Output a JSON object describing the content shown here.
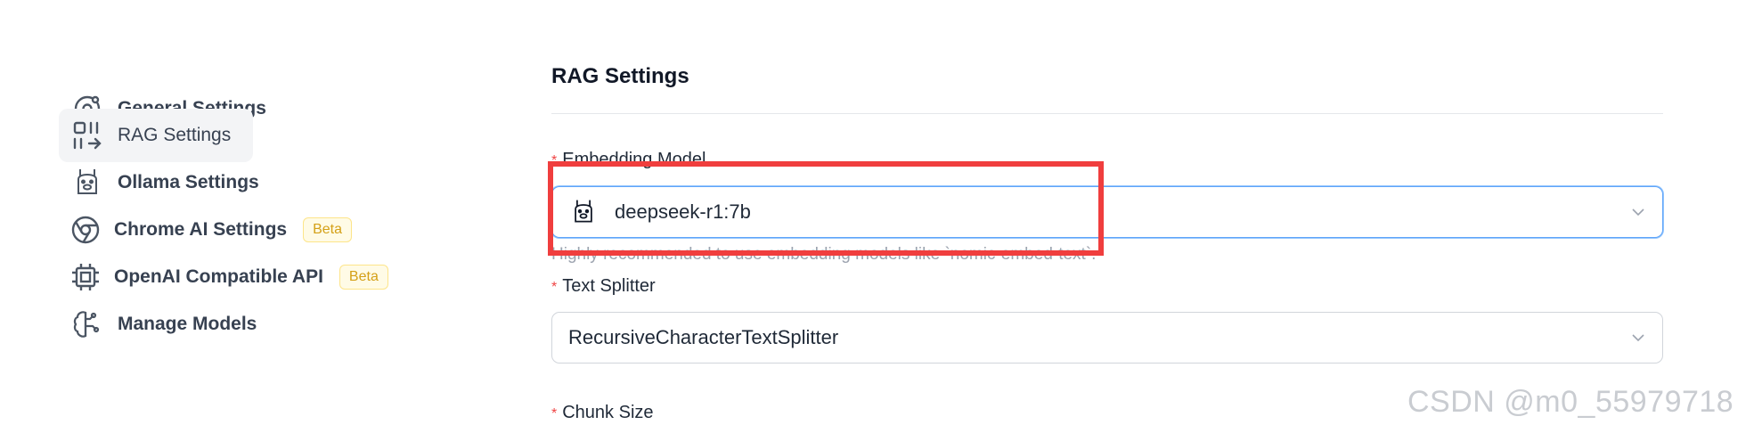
{
  "sidebar": {
    "items": [
      {
        "label": "General Settings",
        "icon": "settings-icon"
      },
      {
        "label": "RAG Settings",
        "icon": "rag-icon",
        "active": true
      },
      {
        "label": "Ollama Settings",
        "icon": "llama-icon"
      },
      {
        "label": "Chrome AI Settings",
        "icon": "chrome-icon",
        "badge": "Beta"
      },
      {
        "label": "OpenAI Compatible API",
        "icon": "chip-icon",
        "badge": "Beta"
      },
      {
        "label": "Manage Models",
        "icon": "brain-icon"
      }
    ]
  },
  "main": {
    "title": "RAG Settings",
    "embedding": {
      "label": "Embedding Model",
      "value": "deepseek-r1:7b",
      "help": "Highly recommended to use embedding models like `nomic-embed-text`."
    },
    "splitter": {
      "label": "Text Splitter",
      "value": "RecursiveCharacterTextSplitter"
    },
    "chunk": {
      "label": "Chunk Size"
    }
  },
  "watermark": "CSDN @m0_55979718",
  "colors": {
    "highlight": "#f03e3e",
    "required": "#ef4444",
    "badge": "#d4a017",
    "focus": "#60a5fa"
  }
}
